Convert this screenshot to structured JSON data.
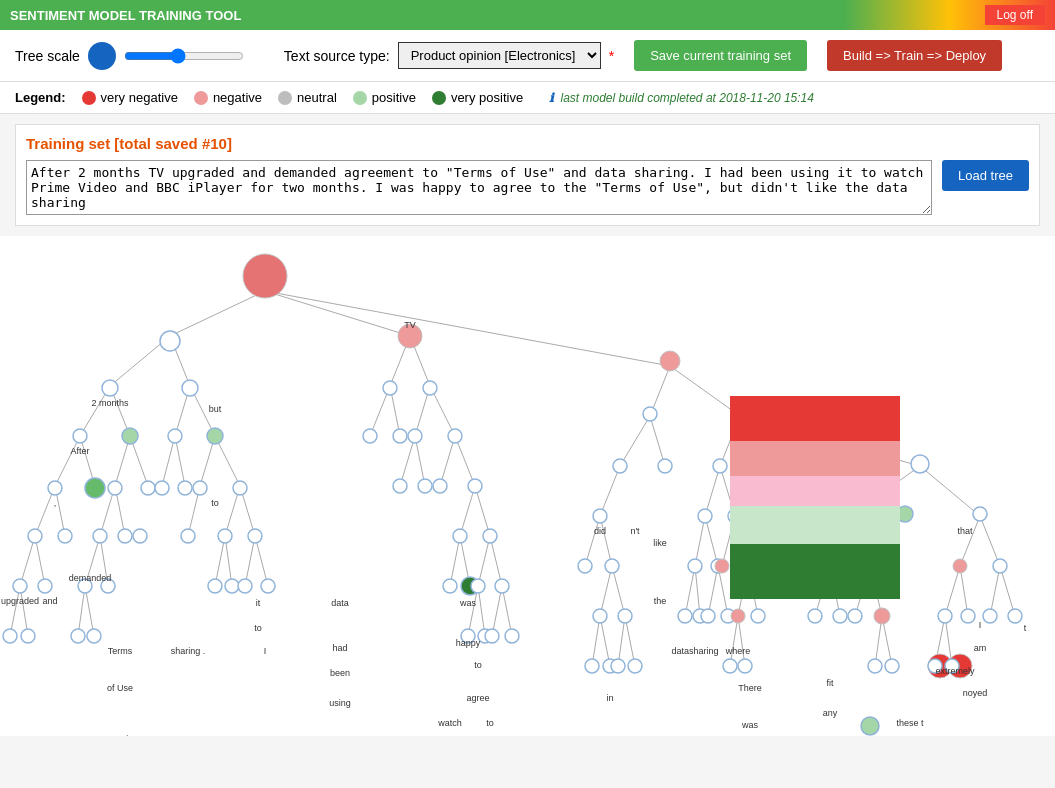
{
  "header": {
    "title": "SENTIMENT MODEL TRAINING TOOL",
    "logoff_label": "Log off"
  },
  "toolbar": {
    "tree_scale_label": "Tree scale",
    "text_source_label": "Text source type:",
    "text_source_value": "Product opinion [Electronics]",
    "asterisk": "*",
    "save_label": "Save current training set",
    "build_label": "Build => Train => Deploy"
  },
  "legend": {
    "label": "Legend:",
    "items": [
      {
        "name": "very negative",
        "color": "#e53935"
      },
      {
        "name": "negative",
        "color": "#ef9a9a"
      },
      {
        "name": "neutral",
        "color": "#bdbdbd"
      },
      {
        "name": "positive",
        "color": "#a5d6a7"
      },
      {
        "name": "very positive",
        "color": "#2e7d32"
      }
    ],
    "last_model_info": "last model build completed at 2018-11-20 15:14"
  },
  "training": {
    "title": "Training set [total saved #10]",
    "text": "After 2 months TV upgraded and demanded agreement to \"Terms of Use\" and data sharing. I had been using it to watch Prime Video and BBC iPlayer for two months. I was happy to agree to the \"Terms of Use\", but didn't like the data sharing",
    "load_tree_label": "Load tree"
  }
}
